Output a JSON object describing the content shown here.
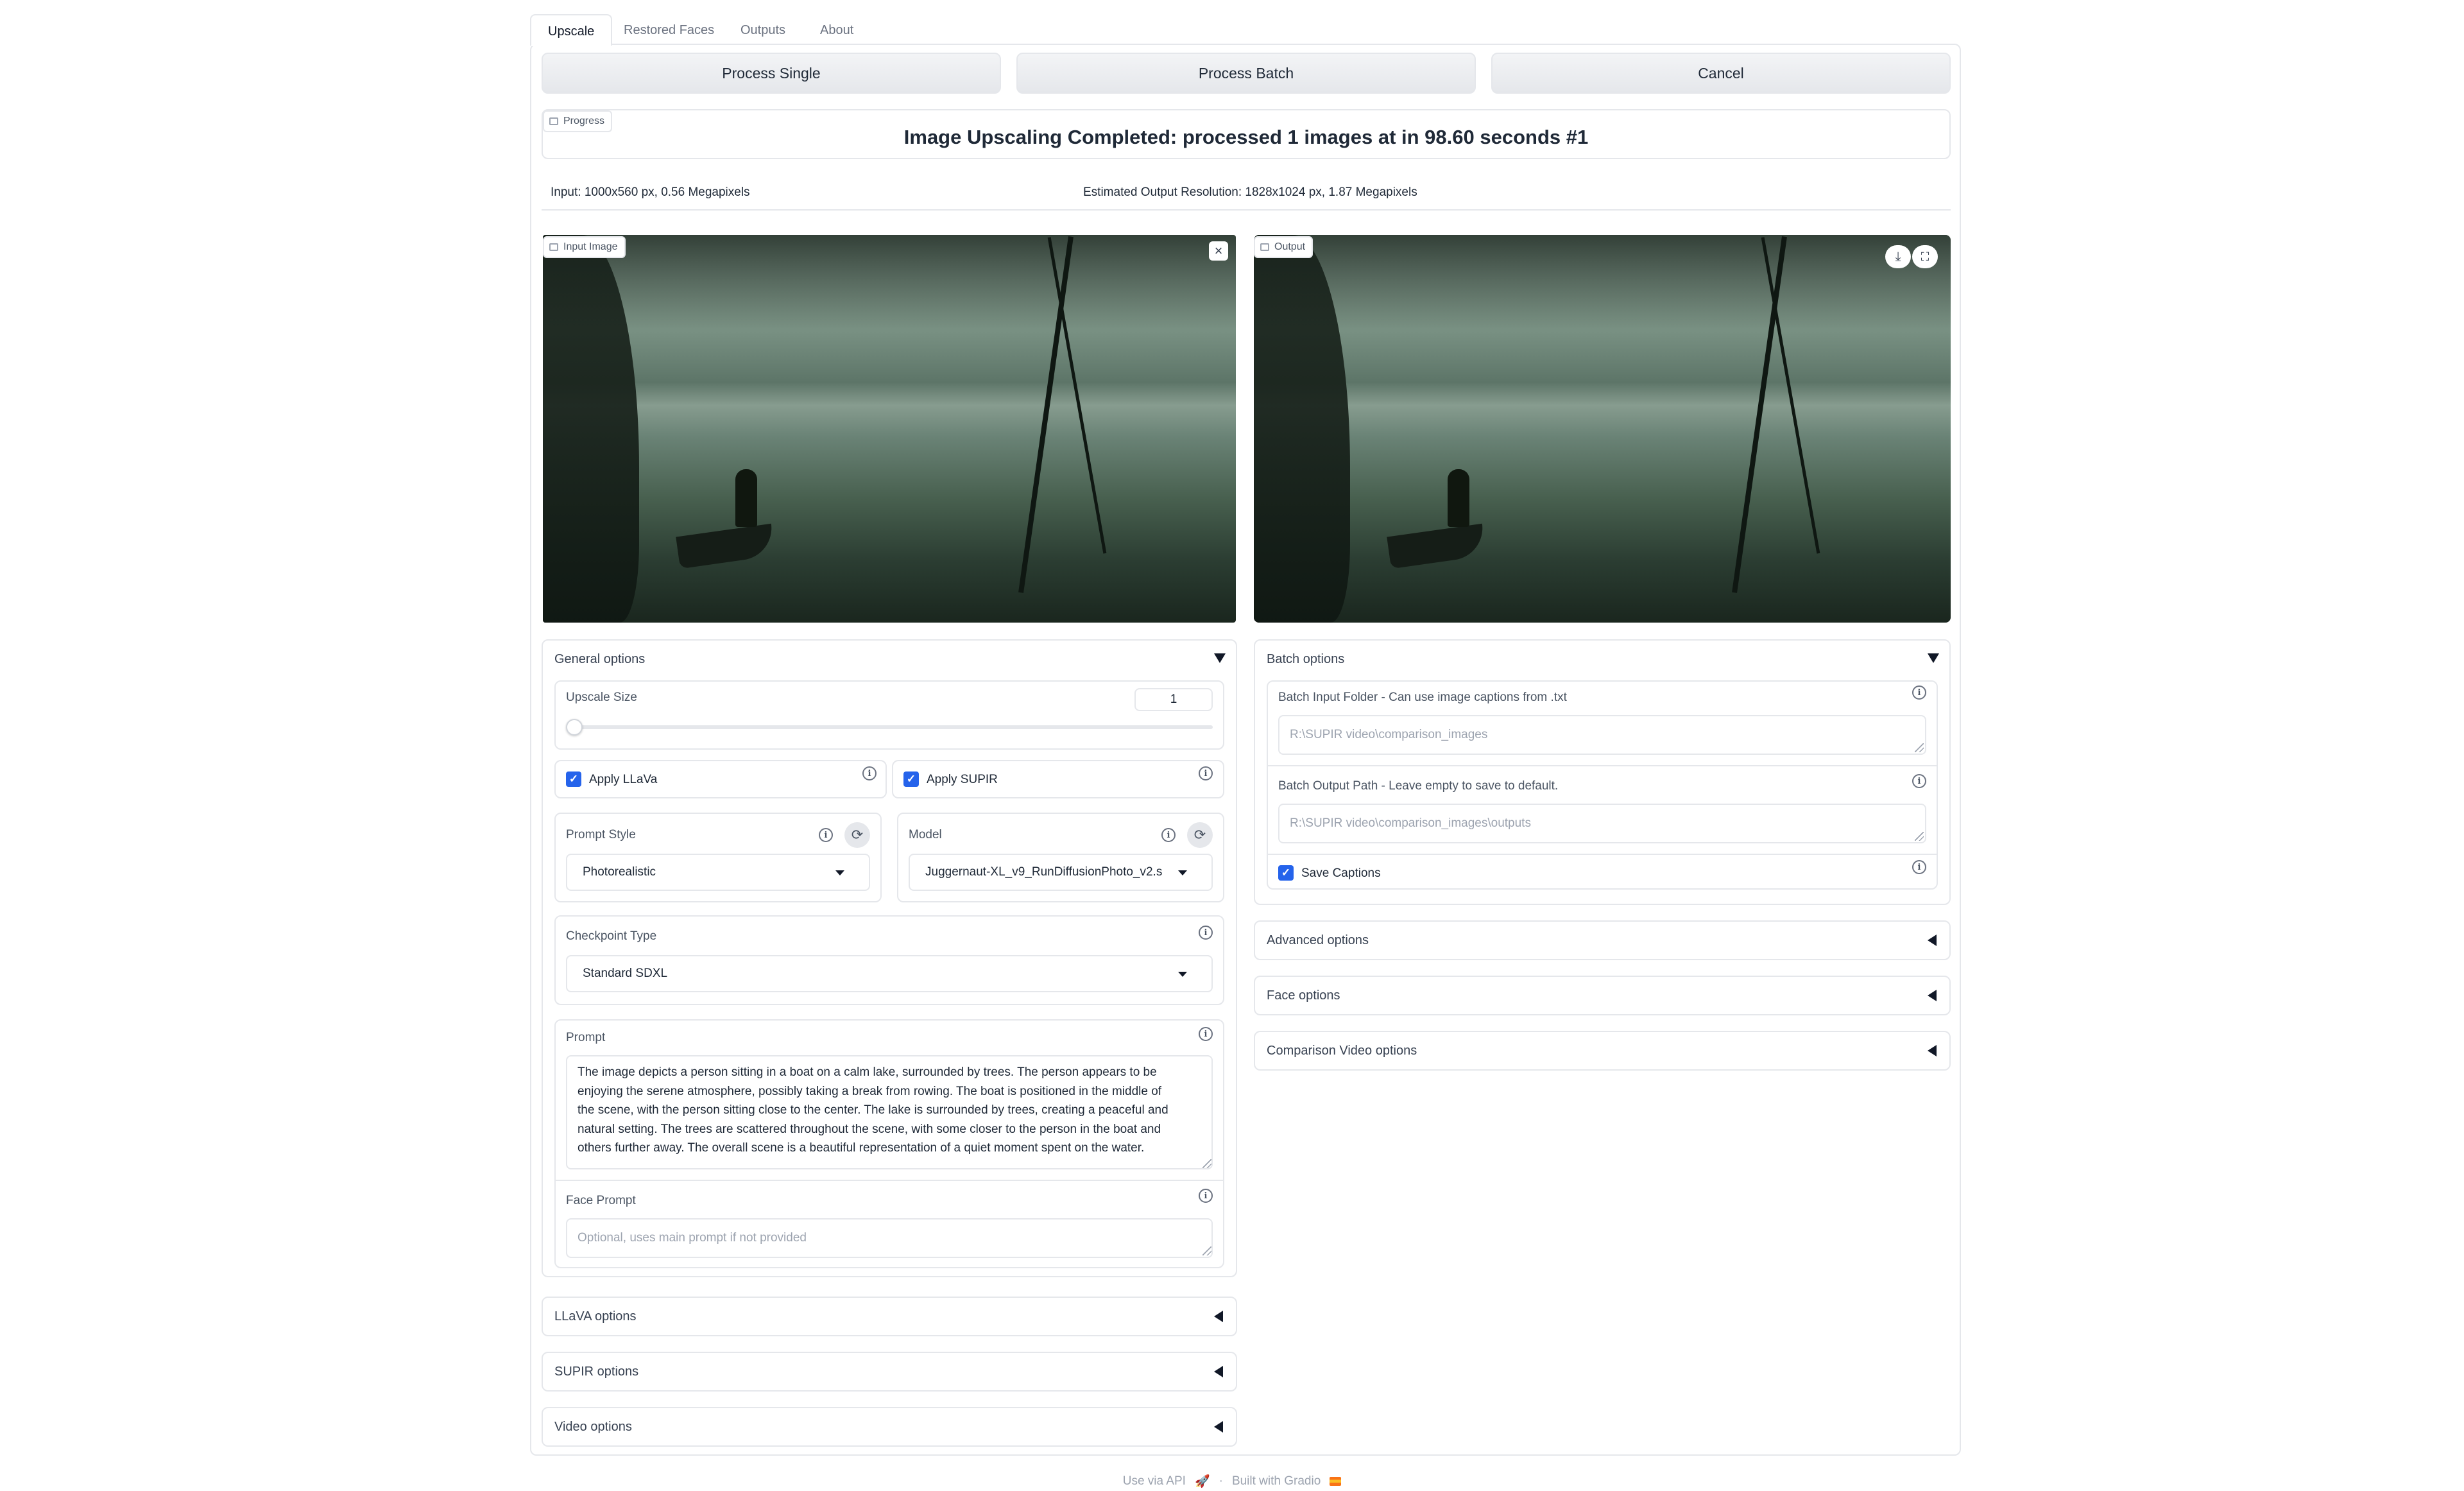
{
  "tabs": [
    {
      "label": "Upscale",
      "active": true
    },
    {
      "label": "Restored Faces",
      "active": false
    },
    {
      "label": "Outputs",
      "active": false
    },
    {
      "label": "About",
      "active": false
    }
  ],
  "actions": {
    "process_single": "Process Single",
    "process_batch": "Process Batch",
    "cancel": "Cancel"
  },
  "progress": {
    "label": "Progress",
    "status": "Image Upscaling Completed: processed 1 images at in 98.60 seconds #1"
  },
  "info_bar": {
    "input": "Input: 1000x560 px, 0.56 Megapixels",
    "estimated": "Estimated Output Resolution: 1828x1024 px, 1.87 Megapixels"
  },
  "input_image": {
    "label": "Input Image"
  },
  "output_image": {
    "label": "Output"
  },
  "general_options": {
    "title": "General options",
    "upscale_size": {
      "label": "Upscale Size",
      "value": "1"
    },
    "apply_llava": {
      "label": "Apply LLaVa",
      "checked": true
    },
    "apply_supir": {
      "label": "Apply SUPIR",
      "checked": true
    },
    "prompt_style": {
      "label": "Prompt Style",
      "value": "Photorealistic"
    },
    "model": {
      "label": "Model",
      "value": "Juggernaut-XL_v9_RunDiffusionPhoto_v2.s"
    },
    "checkpoint_type": {
      "label": "Checkpoint Type",
      "value": "Standard SDXL"
    },
    "prompt": {
      "label": "Prompt",
      "lines": [
        "The image depicts a person sitting in a boat on a calm lake, surrounded by trees. The person appears to be",
        "enjoying the serene atmosphere, possibly taking a break from rowing. The boat is positioned in the middle of",
        "the scene, with the person sitting close to the center.  The lake is surrounded by trees, creating a peaceful and",
        "natural setting. The trees are scattered throughout the scene, with some closer to the person in the boat and",
        "others further away. The overall scene is a beautiful representation of a quiet moment spent on the water."
      ]
    },
    "face_prompt": {
      "label": "Face Prompt",
      "placeholder": "Optional, uses main prompt if not provided"
    }
  },
  "batch_options": {
    "title": "Batch options",
    "input_folder": {
      "label": "Batch Input Folder - Can use image captions from .txt",
      "placeholder": "R:\\SUPIR video\\comparison_images"
    },
    "output_path": {
      "label": "Batch Output Path - Leave empty to save to default.",
      "placeholder": "R:\\SUPIR video\\comparison_images\\outputs"
    },
    "save_captions": {
      "label": "Save Captions",
      "checked": true
    }
  },
  "right_accordions": [
    "Advanced options",
    "Face options",
    "Comparison Video options"
  ],
  "left_accordions": [
    "LLaVA options",
    "SUPIR options",
    "Video options"
  ],
  "footer": {
    "api": "Use via API",
    "sep": "·",
    "built": "Built with Gradio"
  },
  "colors": {
    "accent": "#2563eb",
    "border": "#e5e7eb"
  }
}
